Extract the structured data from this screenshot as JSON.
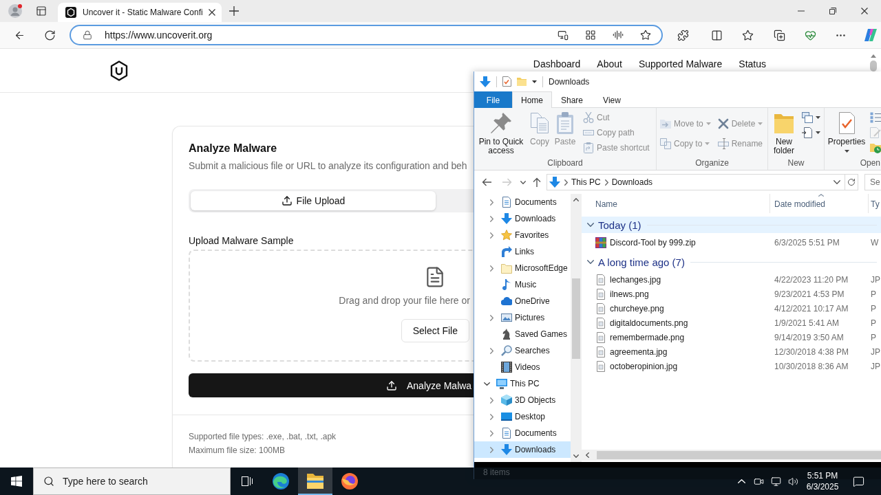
{
  "browser": {
    "tab": {
      "title": "Uncover it - Static Malware Confi",
      "selected": true
    },
    "address": "https://www.uncoverit.org"
  },
  "page": {
    "nav_links": [
      "Dashboard",
      "About",
      "Supported Malware",
      "Status"
    ],
    "card": {
      "title": "Analyze Malware",
      "subtitle": "Submit a malicious file or URL to analyze its configuration and beh",
      "tabs": [
        {
          "label": "File Upload",
          "selected": true
        }
      ],
      "field_label": "Upload Malware Sample",
      "dropzone_text": "Drag and drop your file here or",
      "select_button": "Select File",
      "submit_button": "Analyze Malwa",
      "notes": [
        "Supported file types: .exe, .bat, .txt, .apk",
        "Maximum file size: 100MB"
      ]
    }
  },
  "explorer": {
    "title": "Downloads",
    "ribbon_tabs": [
      {
        "label": "File",
        "kind": "menu",
        "selected": false
      },
      {
        "label": "Home",
        "kind": "tab",
        "selected": true
      },
      {
        "label": "Share",
        "kind": "tab",
        "selected": false
      },
      {
        "label": "View",
        "kind": "tab",
        "selected": false
      }
    ],
    "ribbon_groups": [
      {
        "label": "Clipboard",
        "large": [
          {
            "label": "Pin to Quick access",
            "kind": "pin",
            "disabled": false,
            "dropdown": false
          },
          {
            "label": "Copy",
            "kind": "copy",
            "disabled": true,
            "dropdown": false
          },
          {
            "label": "Paste",
            "kind": "paste",
            "disabled": true,
            "dropdown": false
          }
        ],
        "columns": [
          [
            {
              "label": "Cut",
              "kind": "cut",
              "disabled": true,
              "dropdown": false
            },
            {
              "label": "Copy path",
              "kind": "path",
              "disabled": true,
              "dropdown": false
            },
            {
              "label": "Paste shortcut",
              "kind": "shortcut",
              "disabled": true,
              "dropdown": false
            }
          ]
        ]
      },
      {
        "label": "Organize",
        "columns": [
          [
            {
              "label": "Move to",
              "kind": "move",
              "disabled": true,
              "dropdown": true
            },
            {
              "label": "Copy to",
              "kind": "copyto",
              "disabled": true,
              "dropdown": true
            }
          ],
          [
            {
              "label": "Delete",
              "kind": "delete",
              "disabled": true,
              "dropdown": true
            },
            {
              "label": "Rename",
              "kind": "rename",
              "disabled": true,
              "dropdown": false
            }
          ]
        ]
      },
      {
        "label": "New",
        "large": [
          {
            "label": "New folder",
            "kind": "newfolder",
            "disabled": false,
            "dropdown": false
          }
        ],
        "columns": [
          [
            {
              "kind": "newitem",
              "disabled": false,
              "dropdown": true
            },
            {
              "kind": "easyaccess",
              "disabled": false,
              "dropdown": true
            }
          ]
        ]
      },
      {
        "label": "Open",
        "large": [
          {
            "label": "Properties",
            "kind": "properties",
            "disabled": false,
            "dropdown": true
          }
        ],
        "columns": [
          [
            {
              "kind": "open",
              "disabled": false,
              "dropdown": false
            },
            {
              "kind": "edit",
              "disabled": true,
              "dropdown": false
            },
            {
              "kind": "history",
              "disabled": false,
              "dropdown": false
            }
          ]
        ]
      }
    ],
    "address": {
      "nav": [
        {
          "kind": "back",
          "disabled": false
        },
        {
          "kind": "forward",
          "disabled": true
        },
        {
          "kind": "recent",
          "disabled": false
        },
        {
          "kind": "up",
          "disabled": false
        }
      ],
      "path": [
        "This PC",
        "Downloads"
      ],
      "search_placeholder": "Se"
    },
    "nav_pane": {
      "continued": [
        {
          "label": "Documents",
          "kind": "documents",
          "expandable": true,
          "expanded": false,
          "selected": false
        },
        {
          "label": "Downloads",
          "kind": "downloads",
          "expandable": true,
          "expanded": false,
          "selected": false
        },
        {
          "label": "Favorites",
          "kind": "star",
          "expandable": true,
          "expanded": false,
          "selected": false
        },
        {
          "label": "Links",
          "kind": "link",
          "expandable": false,
          "selected": false
        },
        {
          "label": "MicrosoftEdge",
          "kind": "folder",
          "expandable": true,
          "expanded": false,
          "selected": false
        },
        {
          "label": "Music",
          "kind": "music",
          "expandable": false,
          "selected": false
        },
        {
          "label": "OneDrive",
          "kind": "cloud",
          "expandable": false,
          "selected": false
        },
        {
          "label": "Pictures",
          "kind": "pictures",
          "expandable": true,
          "expanded": false,
          "selected": false
        },
        {
          "label": "Saved Games",
          "kind": "games",
          "expandable": false,
          "selected": false
        },
        {
          "label": "Searches",
          "kind": "search",
          "expandable": true,
          "expanded": false,
          "selected": false
        },
        {
          "label": "Videos",
          "kind": "videos",
          "expandable": false,
          "selected": false
        }
      ],
      "items": [
        {
          "label": "This PC",
          "kind": "computer",
          "expandable": true,
          "expanded": true,
          "selected": false,
          "children": [
            {
              "label": "3D Objects",
              "kind": "cube",
              "expandable": true,
              "expanded": false,
              "selected": false
            },
            {
              "label": "Desktop",
              "kind": "desktop",
              "expandable": true,
              "expanded": false,
              "selected": false
            },
            {
              "label": "Documents",
              "kind": "documents",
              "expandable": true,
              "expanded": false,
              "selected": false
            },
            {
              "label": "Downloads",
              "kind": "downloads",
              "expandable": true,
              "expanded": false,
              "selected": true
            }
          ]
        }
      ]
    },
    "file_list": {
      "columns": [
        {
          "label": "Name",
          "sorted": false
        },
        {
          "label": "Date modified",
          "sorted": true
        },
        {
          "label": "Ty",
          "sorted": false
        }
      ],
      "groups": [
        {
          "label": "Today (1)",
          "expanded": true,
          "highlighted": true,
          "files": [
            {
              "name": "Discord-Tool by 999.zip",
              "kind": "archive",
              "date": "6/3/2025 5:51 PM",
              "type": "W"
            }
          ]
        },
        {
          "label": "A long time ago (7)",
          "expanded": true,
          "highlighted": false,
          "files": [
            {
              "name": "lechanges.jpg",
              "kind": "image",
              "date": "4/22/2023 11:20 PM",
              "type": "JP"
            },
            {
              "name": "ilnews.png",
              "kind": "image",
              "date": "9/23/2021 4:53 PM",
              "type": "P"
            },
            {
              "name": "churcheye.png",
              "kind": "image",
              "date": "4/12/2021 10:17 AM",
              "type": "P"
            },
            {
              "name": "digitaldocuments.png",
              "kind": "image",
              "date": "1/9/2021 5:41 AM",
              "type": "P"
            },
            {
              "name": "remembermade.png",
              "kind": "image",
              "date": "9/14/2019 3:50 AM",
              "type": "P"
            },
            {
              "name": "agreementa.jpg",
              "kind": "image",
              "date": "12/30/2018 4:38 PM",
              "type": "JP"
            },
            {
              "name": "octoberopinion.jpg",
              "kind": "image",
              "date": "10/30/2018 8:36 AM",
              "type": "JP"
            }
          ]
        }
      ]
    },
    "status": "8 items"
  },
  "taskbar": {
    "search_placeholder": "Type here to search",
    "apps": [
      {
        "kind": "edge",
        "active": false
      },
      {
        "kind": "explorer",
        "active": true
      },
      {
        "kind": "firefox",
        "active": false
      }
    ],
    "time": "5:51 PM",
    "date": "6/3/2025"
  }
}
